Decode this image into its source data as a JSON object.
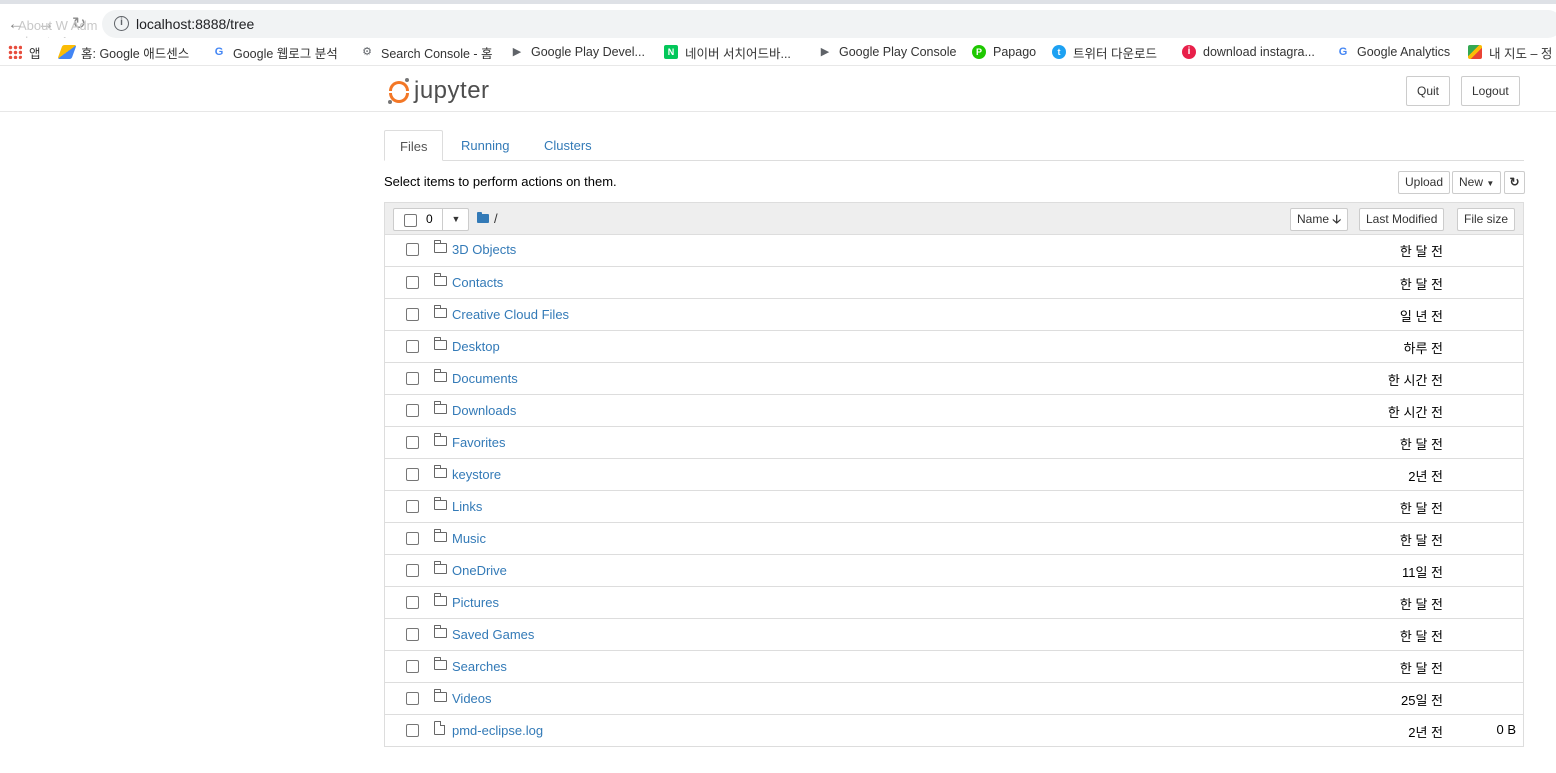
{
  "browser": {
    "url": "localhost:8888/tree",
    "ghost_tab_text": "About W Adm",
    "ghost_tab_text2": "aboutw4.com"
  },
  "bookmarks": [
    {
      "label": "앱",
      "icon": "apps-grid-icon"
    },
    {
      "label": "홈: Google 애드센스",
      "icon": "google-adsense-icon"
    },
    {
      "label": "Google 웹로그 분석",
      "icon": "google-icon"
    },
    {
      "label": "Search Console - 홈",
      "icon": "search-console-icon"
    },
    {
      "label": "Google Play Devel...",
      "icon": "google-play-icon"
    },
    {
      "label": "네이버 서치어드바...",
      "icon": "naver-icon"
    },
    {
      "label": "Google Play Console",
      "icon": "google-play-icon"
    },
    {
      "label": "Papago",
      "icon": "papago-icon"
    },
    {
      "label": "트위터 다운로드",
      "icon": "twitter-download-icon"
    },
    {
      "label": "download instagra...",
      "icon": "info-red-icon"
    },
    {
      "label": "Google Analytics",
      "icon": "google-icon"
    },
    {
      "label": "내 지도 – 정",
      "icon": "maps-icon"
    }
  ],
  "header": {
    "logo_text": "jupyter",
    "quit_label": "Quit",
    "logout_label": "Logout"
  },
  "tabs": [
    {
      "label": "Files",
      "active": true
    },
    {
      "label": "Running",
      "active": false
    },
    {
      "label": "Clusters",
      "active": false
    }
  ],
  "toolbar": {
    "hint": "Select items to perform actions on them.",
    "upload_label": "Upload",
    "new_label": "New",
    "refresh_icon": "refresh-icon"
  },
  "list_header": {
    "selected_count": "0",
    "breadcrumb": "/",
    "name_label": "Name",
    "last_modified_label": "Last Modified",
    "file_size_label": "File size"
  },
  "items": [
    {
      "name": "3D Objects",
      "type": "folder",
      "modified": "한 달 전",
      "size": ""
    },
    {
      "name": "Contacts",
      "type": "folder",
      "modified": "한 달 전",
      "size": ""
    },
    {
      "name": "Creative Cloud Files",
      "type": "folder",
      "modified": "일 년 전",
      "size": ""
    },
    {
      "name": "Desktop",
      "type": "folder",
      "modified": "하루 전",
      "size": ""
    },
    {
      "name": "Documents",
      "type": "folder",
      "modified": "한 시간 전",
      "size": ""
    },
    {
      "name": "Downloads",
      "type": "folder",
      "modified": "한 시간 전",
      "size": ""
    },
    {
      "name": "Favorites",
      "type": "folder",
      "modified": "한 달 전",
      "size": ""
    },
    {
      "name": "keystore",
      "type": "folder",
      "modified": "2년 전",
      "size": ""
    },
    {
      "name": "Links",
      "type": "folder",
      "modified": "한 달 전",
      "size": ""
    },
    {
      "name": "Music",
      "type": "folder",
      "modified": "한 달 전",
      "size": ""
    },
    {
      "name": "OneDrive",
      "type": "folder",
      "modified": "11일 전",
      "size": ""
    },
    {
      "name": "Pictures",
      "type": "folder",
      "modified": "한 달 전",
      "size": ""
    },
    {
      "name": "Saved Games",
      "type": "folder",
      "modified": "한 달 전",
      "size": ""
    },
    {
      "name": "Searches",
      "type": "folder",
      "modified": "한 달 전",
      "size": ""
    },
    {
      "name": "Videos",
      "type": "folder",
      "modified": "25일 전",
      "size": ""
    },
    {
      "name": "pmd-eclipse.log",
      "type": "file",
      "modified": "2년 전",
      "size": "0 B"
    }
  ]
}
